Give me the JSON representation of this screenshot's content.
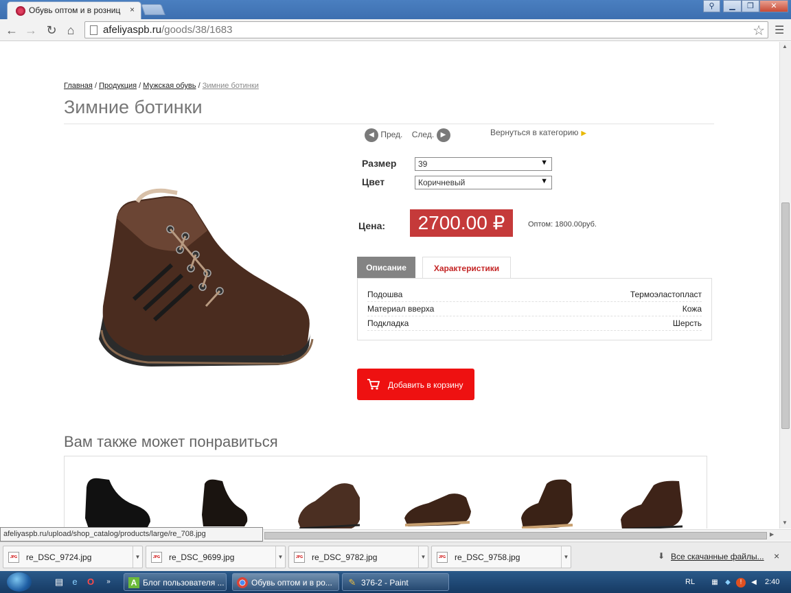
{
  "browser": {
    "tab_title": "Обувь оптом и в розниц",
    "tab_close": "×",
    "url_host": "afeliyaspb.ru",
    "url_path": "/goods/38/1683",
    "window_buttons": [
      "⚲",
      "▁",
      "❐",
      "✕"
    ]
  },
  "page": {
    "breadcrumb": [
      "Главная",
      "Продукция",
      "Мужская обувь",
      "Зимние ботинки"
    ],
    "breadcrumb_sep": "/",
    "title": "Зимние ботинки",
    "prev_label": "Пред.",
    "next_label": "След.",
    "back_to_category": "Вернуться в категорию",
    "size_label": "Размер",
    "size_value": "39",
    "color_label": "Цвет",
    "color_value": "Коричневый",
    "price_label": "Цена:",
    "price": "2700.00 ₽",
    "wholesale": "Оптом: 1800.00руб.",
    "tabs": [
      "Описание",
      "Характеристики"
    ],
    "characteristics": [
      {
        "key": "Подошва",
        "value": "Термоэластопласт"
      },
      {
        "key": "Материал вверха",
        "value": "Кожа"
      },
      {
        "key": "Подкладка",
        "value": "Шерсть"
      }
    ],
    "cart_button": "Добавить в корзину",
    "related_title": "Вам также может понравиться"
  },
  "status_url": "afeliyaspb.ru/upload/shop_catalog/products/large/re_708.jpg",
  "downloads": {
    "items": [
      "re_DSC_9724.jpg",
      "re_DSC_9699.jpg",
      "re_DSC_9782.jpg",
      "re_DSC_9758.jpg"
    ],
    "icon_label": "JPG",
    "all_label": "Все скачанные файлы...",
    "close": "×"
  },
  "taskbar": {
    "tasks": [
      "Блог пользователя ...",
      "Обувь оптом и в ро...",
      "376-2 - Paint"
    ],
    "lang": "RL",
    "clock": "2:40"
  },
  "colors": {
    "price_bg": "#c53a3a",
    "cart_bg": "#ee1111",
    "tab_active": "#c42525"
  }
}
